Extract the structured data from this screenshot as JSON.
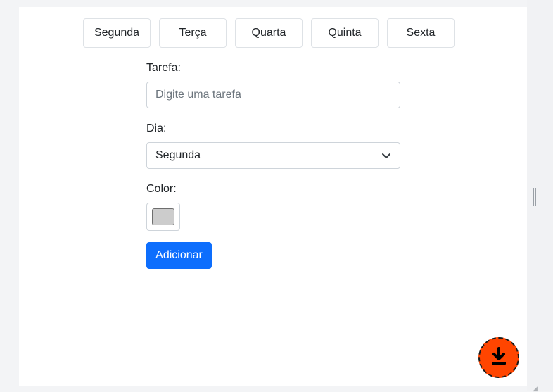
{
  "days": {
    "items": [
      {
        "label": "Segunda"
      },
      {
        "label": "Terça"
      },
      {
        "label": "Quarta"
      },
      {
        "label": "Quinta"
      },
      {
        "label": "Sexta"
      }
    ]
  },
  "form": {
    "task_label": "Tarefa:",
    "task_placeholder": "Digite uma tarefa",
    "task_value": "",
    "day_label": "Dia:",
    "day_selected": "Segunda",
    "color_label": "Color:",
    "color_value": "#cccccc",
    "submit_label": "Adicionar"
  },
  "colors": {
    "primary": "#0d6efd",
    "download_fab": "#ff4500"
  },
  "icons": {
    "select_chevron": "chevron-down-icon",
    "download": "download-icon"
  }
}
